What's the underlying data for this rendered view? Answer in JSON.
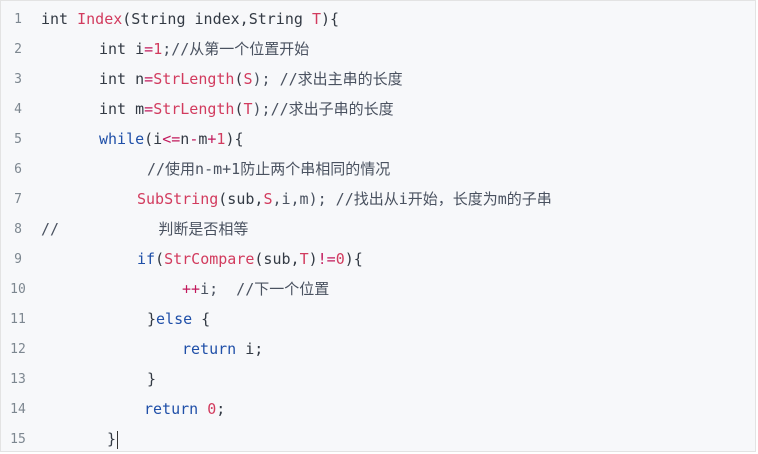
{
  "code_lines": [
    {
      "n": "1",
      "parts": [
        {
          "t": "int ",
          "c": "kw"
        },
        {
          "t": "Index",
          "c": "fn"
        },
        {
          "t": "(String index,String ",
          "c": "kw"
        },
        {
          "t": "T",
          "c": "param"
        },
        {
          "t": "){",
          "c": "kw"
        }
      ]
    },
    {
      "n": "2",
      "parts": [
        {
          "t": "int i",
          "c": "kw"
        },
        {
          "t": "=",
          "c": "op"
        },
        {
          "t": "1",
          "c": "num"
        },
        {
          "t": ";//从第一个位置开始",
          "c": "cm"
        }
      ]
    },
    {
      "n": "3",
      "parts": [
        {
          "t": "int n",
          "c": "kw"
        },
        {
          "t": "=",
          "c": "op"
        },
        {
          "t": "StrLength",
          "c": "fn"
        },
        {
          "t": "(",
          "c": "kw"
        },
        {
          "t": "S",
          "c": "param"
        },
        {
          "t": "); //求出主串的长度",
          "c": "cm"
        }
      ]
    },
    {
      "n": "4",
      "parts": [
        {
          "t": "int m",
          "c": "kw"
        },
        {
          "t": "=",
          "c": "op"
        },
        {
          "t": "StrLength",
          "c": "fn"
        },
        {
          "t": "(",
          "c": "kw"
        },
        {
          "t": "T",
          "c": "param"
        },
        {
          "t": ");//求出子串的长度",
          "c": "cm"
        }
      ]
    },
    {
      "n": "5",
      "parts": [
        {
          "t": "while",
          "c": "kw-blue"
        },
        {
          "t": "(i",
          "c": "kw"
        },
        {
          "t": "<=",
          "c": "op"
        },
        {
          "t": "n",
          "c": "kw"
        },
        {
          "t": "-",
          "c": "op"
        },
        {
          "t": "m",
          "c": "kw"
        },
        {
          "t": "+",
          "c": "op"
        },
        {
          "t": "1",
          "c": "num"
        },
        {
          "t": "){",
          "c": "kw"
        }
      ]
    },
    {
      "n": "6",
      "parts": [
        {
          "t": "//使用n-m+1防止两个串相同的情况",
          "c": "cm"
        }
      ]
    },
    {
      "n": "7",
      "parts": [
        {
          "t": "SubString",
          "c": "fn"
        },
        {
          "t": "(sub,",
          "c": "kw"
        },
        {
          "t": "S",
          "c": "param"
        },
        {
          "t": ",i,m); //找出从i开始，长度为m的子串",
          "c": "cm"
        }
      ]
    },
    {
      "n": "8",
      "parts": [
        {
          "t": "//           判断是否相等",
          "c": "cm"
        }
      ]
    },
    {
      "n": "9",
      "parts": [
        {
          "t": "if",
          "c": "kw-blue"
        },
        {
          "t": "(",
          "c": "kw"
        },
        {
          "t": "StrCompare",
          "c": "fn"
        },
        {
          "t": "(sub,",
          "c": "kw"
        },
        {
          "t": "T",
          "c": "param"
        },
        {
          "t": ")",
          "c": "kw"
        },
        {
          "t": "!=",
          "c": "op"
        },
        {
          "t": "0",
          "c": "num"
        },
        {
          "t": "){",
          "c": "kw"
        }
      ]
    },
    {
      "n": "10",
      "parts": [
        {
          "t": "++",
          "c": "op"
        },
        {
          "t": "i;  //下一个位置",
          "c": "cm"
        }
      ]
    },
    {
      "n": "11",
      "parts": [
        {
          "t": "}",
          "c": "kw"
        },
        {
          "t": "else",
          "c": "kw-blue"
        },
        {
          "t": " {",
          "c": "kw"
        }
      ]
    },
    {
      "n": "12",
      "parts": [
        {
          "t": "return",
          "c": "kw-blue"
        },
        {
          "t": " i;",
          "c": "kw"
        }
      ]
    },
    {
      "n": "13",
      "parts": [
        {
          "t": "}",
          "c": "kw"
        }
      ]
    },
    {
      "n": "14",
      "parts": [
        {
          "t": "return",
          "c": "kw-blue"
        },
        {
          "t": " ",
          "c": "kw"
        },
        {
          "t": "0",
          "c": "num"
        },
        {
          "t": ";",
          "c": "kw"
        }
      ]
    },
    {
      "n": "15",
      "parts": [
        {
          "t": "}",
          "c": "kw"
        }
      ]
    }
  ]
}
